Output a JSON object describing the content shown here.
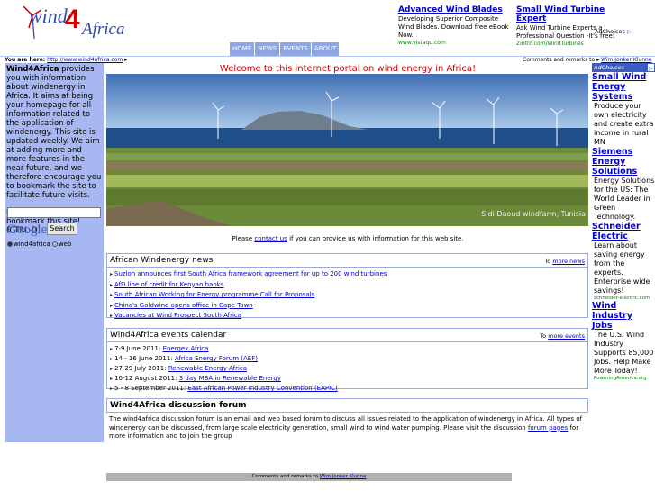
{
  "logo": {
    "wind": "wind",
    "four": "4",
    "africa": "Africa"
  },
  "top_ads": [
    {
      "title": "Advanced Wind Blades",
      "desc": "Developing Superior Composite Wind Blades. Download free eBook Now.",
      "url": "www.vistaqu.com"
    },
    {
      "title": "Small Wind Turbine Expert",
      "desc": "Ask Wind Turbine Experts a Professional Question -It's free!",
      "url": "Zintro.com/WindTurbines"
    }
  ],
  "adchoices": "AdChoices",
  "menu": [
    "HOME",
    "NEWS",
    "EVENTS",
    "ABOUT"
  ],
  "breadcrumb": {
    "label": "You are here:",
    "url": "http://www.wind4africa.com"
  },
  "remarks": {
    "text": "Comments and remarks to",
    "name": "Wim Jonker Klunne"
  },
  "intro": {
    "brand": "Wind4Africa",
    "text": " provides you with information about windenergy in Africa. It aims at being your homepage for all information related to the application of windenergy. This site is updated weekly. We aim at adding more and more features in the near future, and we therefore encourage you to bookmark the site to facilitate future visits.",
    "bookmark": "Don't forget to bookmark this site! (CTRL-D)"
  },
  "search": {
    "button": "Search",
    "google": "Google",
    "radio1": "wind4africa",
    "radio2": "web"
  },
  "welcome": "Welcome to this internet portal on wind energy in Africa!",
  "photo_caption": "Sidi Daoud windfarm, Tunisia",
  "please": {
    "before": "Please ",
    "link": "contact us",
    "after": " if you can provide us with information for this web site."
  },
  "news": {
    "title": "African Windenergy news",
    "more_prefix": "To ",
    "more_link": "more news",
    "items": [
      "Suzlon announces first South Africa framework agreement for up to 200 wind turbines",
      "AfD line of credit for Kenyan banks",
      "South African Working for Energy programme Call for Proposals",
      "China's Goldwind opens office in Cape Town",
      "Vacancies at Wind Prospect South Africa"
    ]
  },
  "events": {
    "title": "Wind4Africa events calendar",
    "more_prefix": "To ",
    "more_link": "more events",
    "items": [
      {
        "date": "7-9 June 2011:",
        "name": "Energex Africa"
      },
      {
        "date": "14 - 16 June 2011:",
        "name": "Africa Energy Forum (AEF)"
      },
      {
        "date": "27-29 July 2011:",
        "name": "Renewable Energy Africa"
      },
      {
        "date": "10-12 August 2011:",
        "name": "3 day MBA in Renewable Energy"
      },
      {
        "date": "5 - 8 September 2011:",
        "name": "East African Power Industry Convention (EAPIC)"
      }
    ]
  },
  "forum": {
    "title": "Wind4Africa discussion forum",
    "text": "The wind4africa discussion forum is an email and web based forum to discuss all issues related to the application of windenergy in Africa. All types of windenergy can be discussed, from large scale electricity generation, small wind to wind water pumping. Please visit the discussion ",
    "link": "forum pages",
    "after": " for more information and to join the group"
  },
  "right_ads": [
    {
      "title": "Small Wind Energy Systems",
      "desc": "Produce your own electricity and create extra income in rural MN",
      "url": ""
    },
    {
      "title": "Siemens Energy Solutions",
      "desc": "Energy Solutions for the US: The World Leader in Green Technology.",
      "url": ""
    },
    {
      "title": "Schneider Electric",
      "desc": "Learn about saving energy from the experts. Enterprise wide savings!",
      "url": "schneider-electric.com"
    },
    {
      "title": "Wind Industry Jobs",
      "desc": "The U.S. Wind Industry Supports 85,000 Jobs. Help Make More Today!",
      "url": "PoweringAmerica.org"
    }
  ],
  "colors": {
    "left_panel": "#a7b7f1",
    "menu": "#8ea6e2",
    "accent_red": "#cc0000",
    "link": "#0000cc"
  }
}
